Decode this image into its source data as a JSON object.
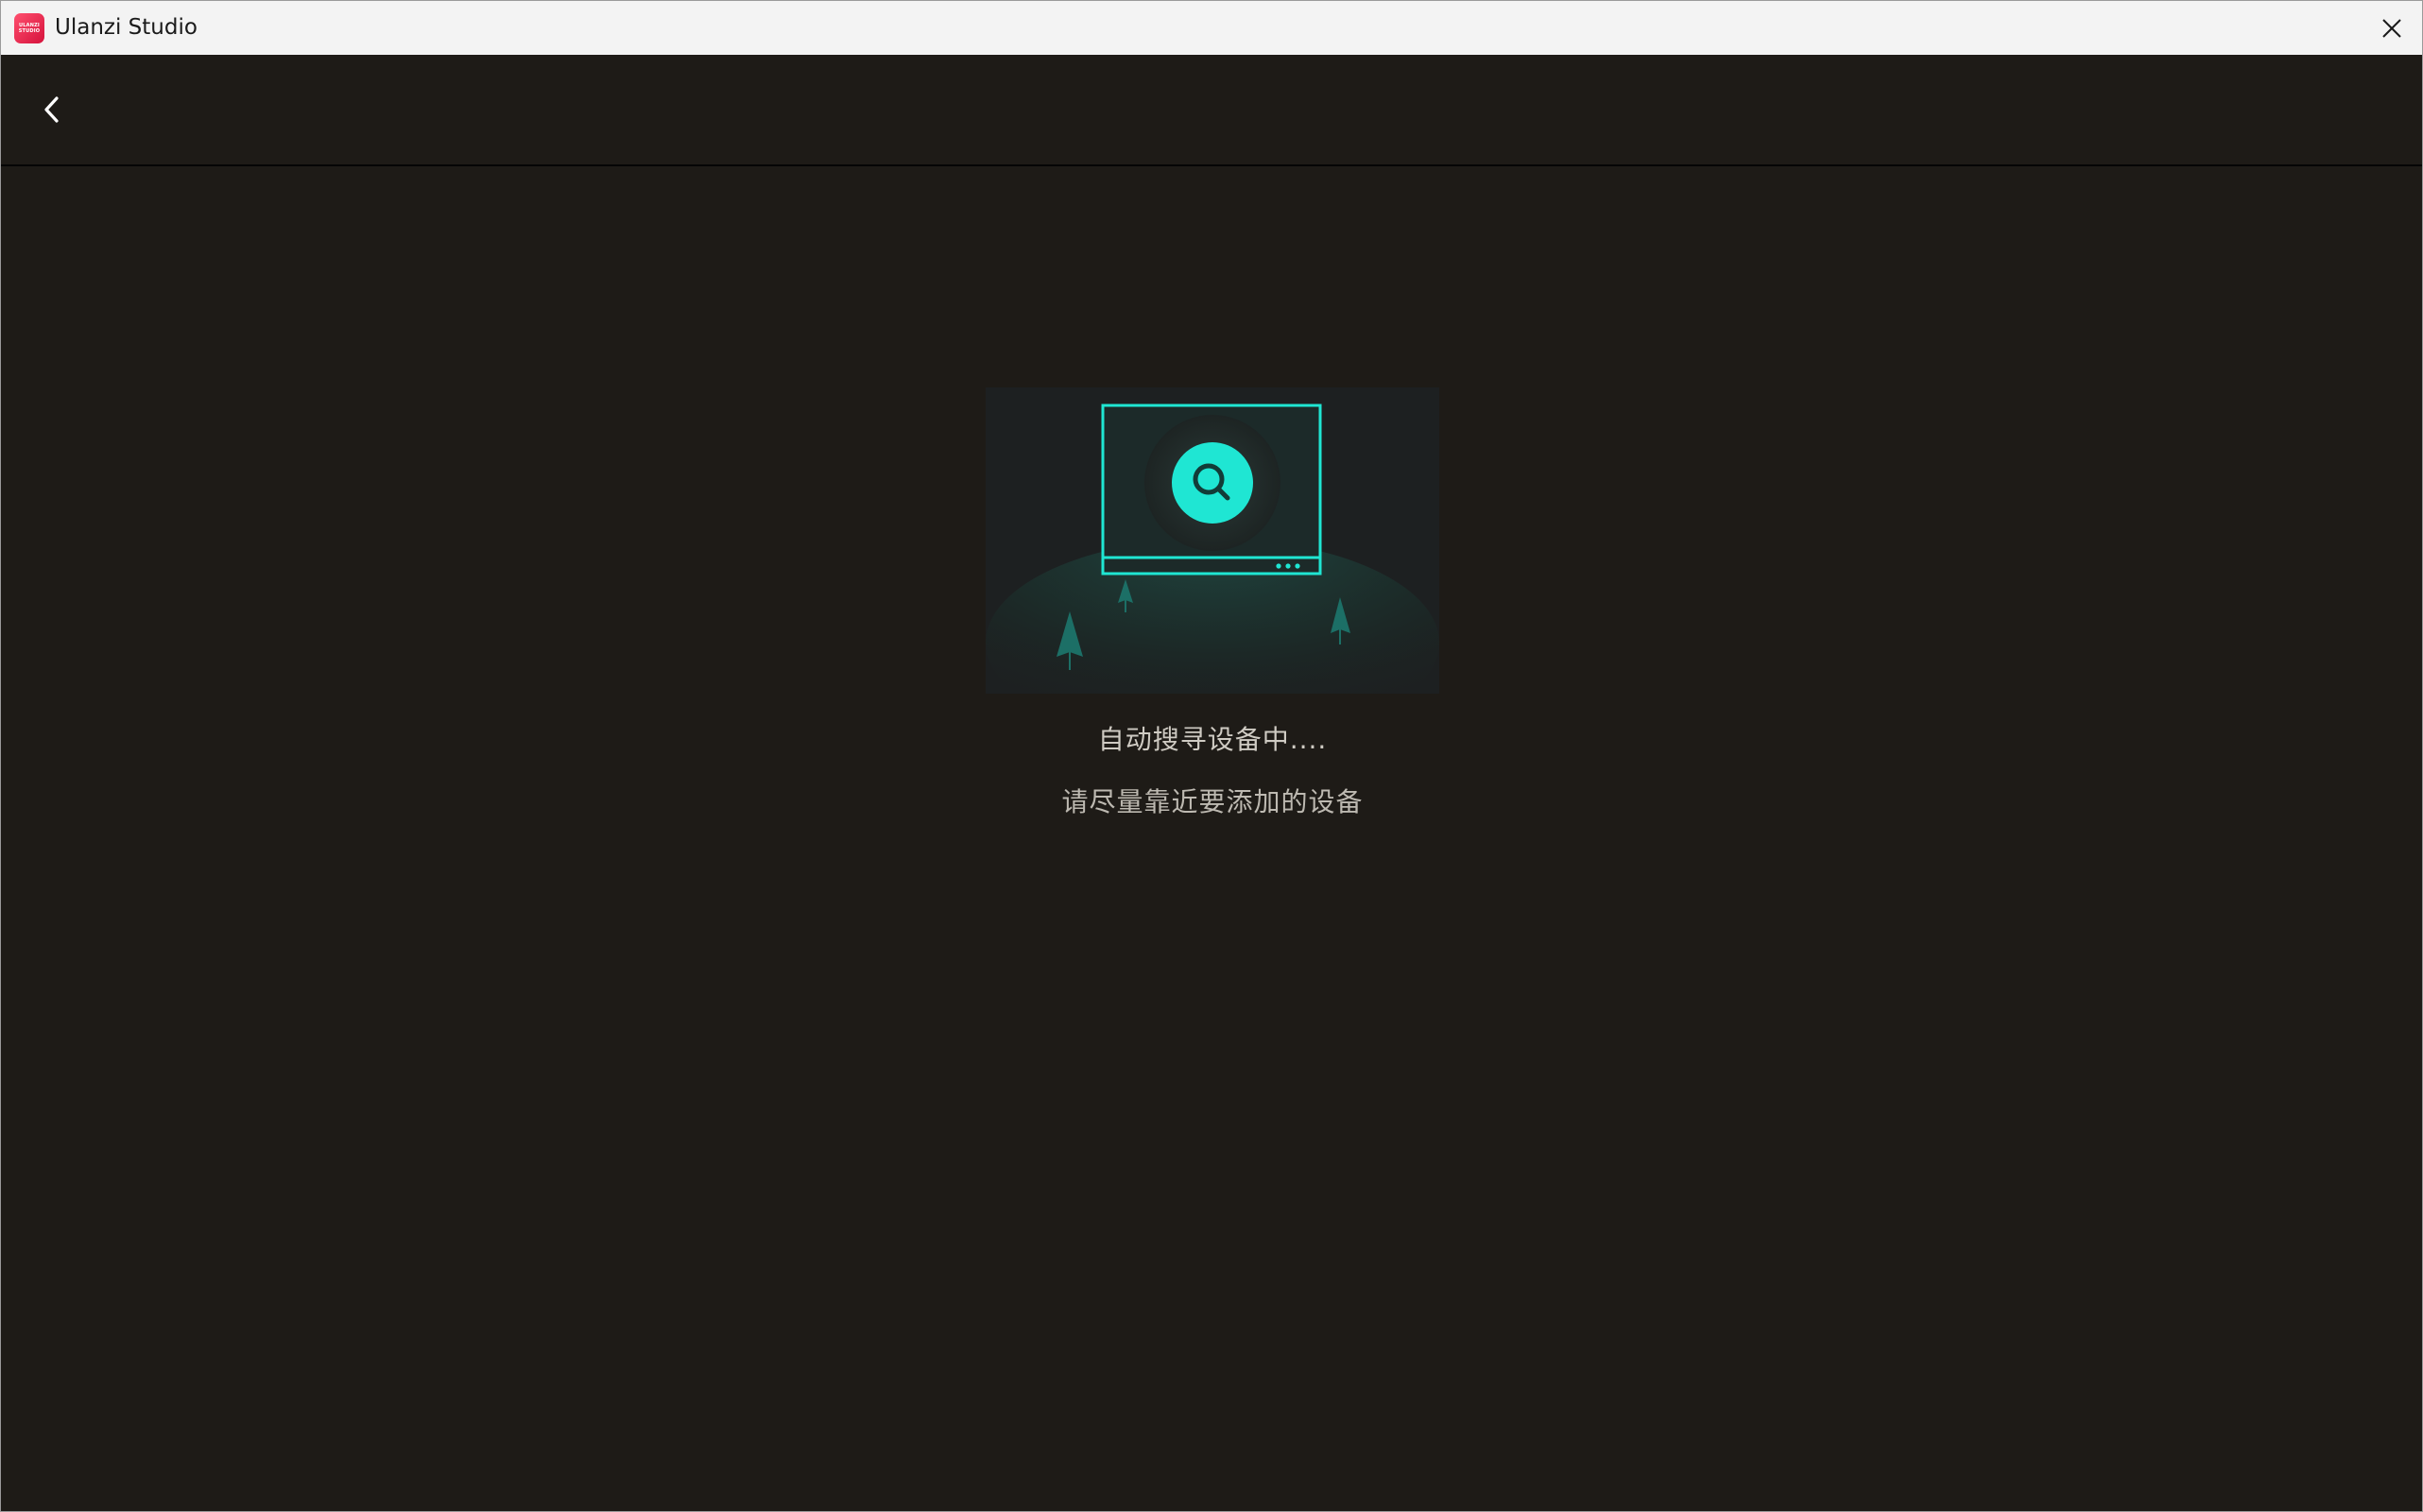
{
  "window": {
    "title": "Ulanzi Studio",
    "app_icon_text": "ULANZI STUDIO"
  },
  "icons": {
    "app": "ulanzi-logo-icon",
    "close": "close-icon",
    "back": "chevron-left-icon",
    "illustration": "device-search-illustration"
  },
  "main": {
    "status": "自动搜寻设备中....",
    "hint": "请尽量靠近要添加的设备"
  },
  "colors": {
    "background": "#1e1b17",
    "accent": "#1fe6d3",
    "titlebar": "#f3f3f3"
  }
}
